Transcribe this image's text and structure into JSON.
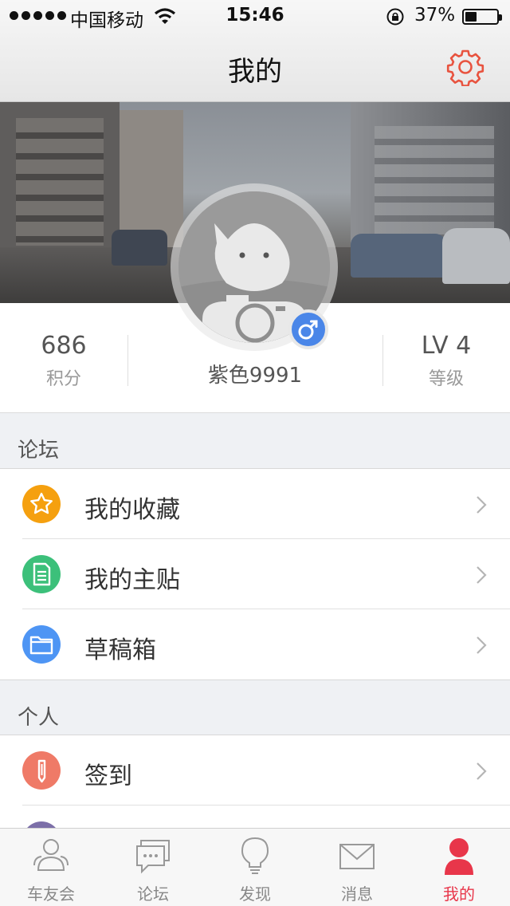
{
  "status_bar": {
    "carrier": "中国移动",
    "time": "15:46",
    "battery_pct": "37%",
    "battery_level": 0.37
  },
  "nav": {
    "title": "我的",
    "settings_icon": "gear-icon",
    "accent": "#e8533f"
  },
  "profile": {
    "points_value": "686",
    "points_label": "积分",
    "username": "紫色9991",
    "level_value": "LV 4",
    "level_label": "等级",
    "gender_icon": "male-icon"
  },
  "sections": [
    {
      "title": "论坛",
      "items": [
        {
          "label": "我的收藏",
          "icon": "star-icon",
          "color": "#f5a00f"
        },
        {
          "label": "我的主贴",
          "icon": "document-icon",
          "color": "#3cc07a"
        },
        {
          "label": "草稿箱",
          "icon": "folder-icon",
          "color": "#4e95f4"
        }
      ]
    },
    {
      "title": "个人",
      "items": [
        {
          "label": "签到",
          "icon": "pen-icon",
          "color": "#ef7a67"
        }
      ]
    }
  ],
  "tabs": [
    {
      "label": "车友会",
      "icon": "group-icon"
    },
    {
      "label": "论坛",
      "icon": "chat-icon"
    },
    {
      "label": "发现",
      "icon": "lightbulb-icon"
    },
    {
      "label": "消息",
      "icon": "mail-icon"
    },
    {
      "label": "我的",
      "icon": "person-icon",
      "active": true
    }
  ],
  "colors": {
    "active_tab": "#e8364a",
    "gender_badge": "#4a86e8"
  }
}
